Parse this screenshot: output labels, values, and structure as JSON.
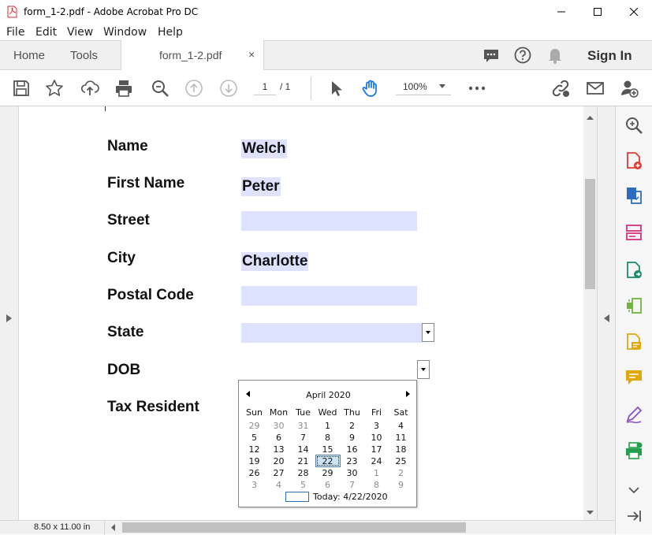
{
  "window": {
    "title": "form_1-2.pdf - Adobe Acrobat Pro DC",
    "accent_color": "#d7282f"
  },
  "menu": [
    "File",
    "Edit",
    "View",
    "Window",
    "Help"
  ],
  "tabs": {
    "home": "Home",
    "tools": "Tools",
    "document": "form_1-2.pdf",
    "close": "×",
    "sign_in": "Sign In"
  },
  "toolbar": {
    "current_page": "1",
    "total_pages": "/  1",
    "zoom": "100%",
    "icons": [
      "save-icon",
      "bookmark-star-icon",
      "upload-icon",
      "print-icon",
      "zoom-search-icon",
      "page-up-icon",
      "page-down-icon",
      "select-cursor-icon",
      "hand-tool-icon",
      "more-icon",
      "share-link-icon",
      "email-icon",
      "add-user-icon"
    ]
  },
  "form": {
    "fields": [
      {
        "label": "Name",
        "value": "Welch"
      },
      {
        "label": "First Name",
        "value": "Peter"
      },
      {
        "label": "Street",
        "value": ""
      },
      {
        "label": "City",
        "value": "Charlotte"
      },
      {
        "label": "Postal Code",
        "value": ""
      },
      {
        "label": "State",
        "value": ""
      },
      {
        "label": "DOB",
        "value": ""
      },
      {
        "label": "Tax Resident",
        "value": ""
      }
    ],
    "field_highlight_color": "#dde3ff"
  },
  "calendar": {
    "month": "April 2020",
    "weekdays": [
      "Sun",
      "Mon",
      "Tue",
      "Wed",
      "Thu",
      "Fri",
      "Sat"
    ],
    "weeks": [
      [
        "29",
        "30",
        "31",
        "1",
        "2",
        "3",
        "4"
      ],
      [
        "5",
        "6",
        "7",
        "8",
        "9",
        "10",
        "11"
      ],
      [
        "12",
        "13",
        "14",
        "15",
        "16",
        "17",
        "18"
      ],
      [
        "19",
        "20",
        "21",
        "22",
        "23",
        "24",
        "25"
      ],
      [
        "26",
        "27",
        "28",
        "29",
        "30",
        "1",
        "2"
      ],
      [
        "3",
        "4",
        "5",
        "6",
        "7",
        "8",
        "9"
      ]
    ],
    "selected_day": "22",
    "today_label": "Today: 4/22/2020"
  },
  "status": {
    "page_size": "8.50 x 11.00 in"
  },
  "right_sidebar": {
    "icons": [
      "zoom-icon",
      "create-pdf-icon",
      "export-pdf-icon",
      "organize-pages-icon",
      "edit-pdf-icon",
      "compress-icon",
      "comment-note-icon",
      "comment-icon",
      "fill-sign-icon",
      "print-production-icon",
      "expand-more-icon",
      "collapse-panel-icon"
    ]
  }
}
